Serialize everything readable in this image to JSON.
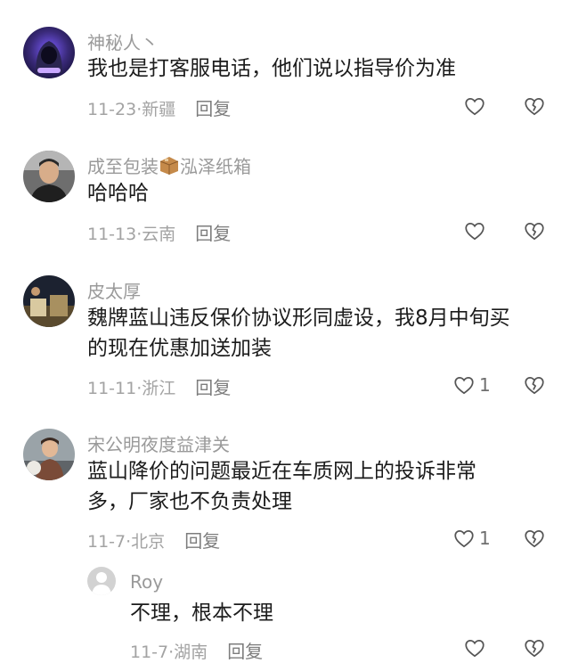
{
  "comments": [
    {
      "username": "神秘人丶",
      "text": "我也是打客服电话，他们说以指导价为准",
      "date": "11-23",
      "location": "新疆",
      "reply_label": "回复",
      "like_count": ""
    },
    {
      "username_part1": "成至包装",
      "username_part2": "泓泽纸箱",
      "text": "哈哈哈",
      "date": "11-13",
      "location": "云南",
      "reply_label": "回复",
      "like_count": ""
    },
    {
      "username": "皮太厚",
      "text_line1": "魏牌蓝山违反保价协议形同虚设，我8月中旬买",
      "text_line2": "的现在优惠加送加装",
      "date": "11-11",
      "location": "浙江",
      "reply_label": "回复",
      "like_count": "1"
    },
    {
      "username": "宋公明夜度益津关",
      "text_line1": "蓝山降价的问题最近在车质网上的投诉非常",
      "text_line2": "多，厂家也不负责处理",
      "date": "11-7",
      "location": "北京",
      "reply_label": "回复",
      "like_count": "1"
    }
  ],
  "reply": {
    "username": "Roy",
    "text": "不理，根本不理",
    "date": "11-7",
    "location": "湖南",
    "reply_label": "回复"
  },
  "icons": {
    "like": "heart-outline-icon",
    "dislike": "broken-heart-outline-icon",
    "emoji": "package-box-emoji"
  },
  "colors": {
    "username": "#9a9a9a",
    "text": "#1c1c1c",
    "meta": "#a3a3a3",
    "icon": "#555555"
  }
}
